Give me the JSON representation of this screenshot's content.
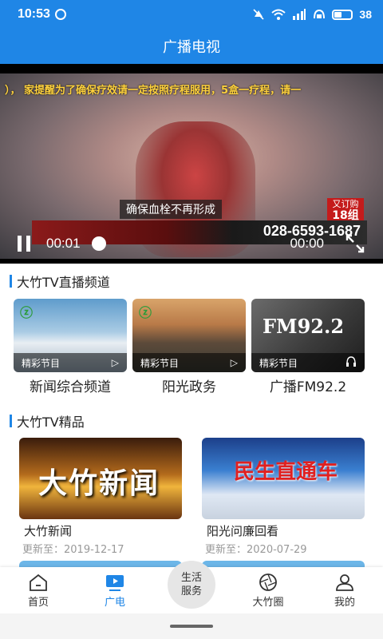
{
  "status": {
    "time": "10:53",
    "battery": "38",
    "icons": [
      "check-circle-icon",
      "mute-icon",
      "wifi-icon",
      "signal-icon",
      "hd-icon",
      "battery-icon"
    ]
  },
  "header": {
    "title": "广播电视"
  },
  "player": {
    "ticker": "）， 家提醒为了确保疗效请一定按照疗程服用，5盒一疗程，请一",
    "subtitle": "确保血栓不再形成",
    "phone": "028-6593-1687",
    "badge_line1": "又订购",
    "badge_line2": "18组",
    "current_time": "00:01",
    "total_time": "00:00"
  },
  "live_section": {
    "title": "大竹TV直播频道",
    "channels": [
      {
        "tag": "精彩节目",
        "name": "新闻综合频道",
        "icon": "play-icon"
      },
      {
        "tag": "精彩节目",
        "name": "阳光政务",
        "icon": "play-icon"
      },
      {
        "tag": "精彩节目",
        "name": "广播FM92.2",
        "icon": "headphones-icon",
        "thumb_text": "FM92.2"
      }
    ]
  },
  "premium_section": {
    "title": "大竹TV精品",
    "items": [
      {
        "title": "大竹新闻",
        "update": "更新至：2019-12-17",
        "thumb_text": "大竹新闻"
      },
      {
        "title": "阳光问廉回看",
        "update": "更新至：2020-07-29",
        "thumb_text": "民生直通车"
      }
    ]
  },
  "tabbar": {
    "tabs": [
      {
        "label": "首页",
        "icon": "home-icon"
      },
      {
        "label": "广电",
        "icon": "tv-play-icon",
        "active": true
      },
      {
        "label": "生活服务",
        "line1": "生活",
        "line2": "服务"
      },
      {
        "label": "大竹圈",
        "icon": "aperture-icon"
      },
      {
        "label": "我的",
        "icon": "person-icon"
      }
    ]
  },
  "colors": {
    "accent": "#1f86e6"
  }
}
